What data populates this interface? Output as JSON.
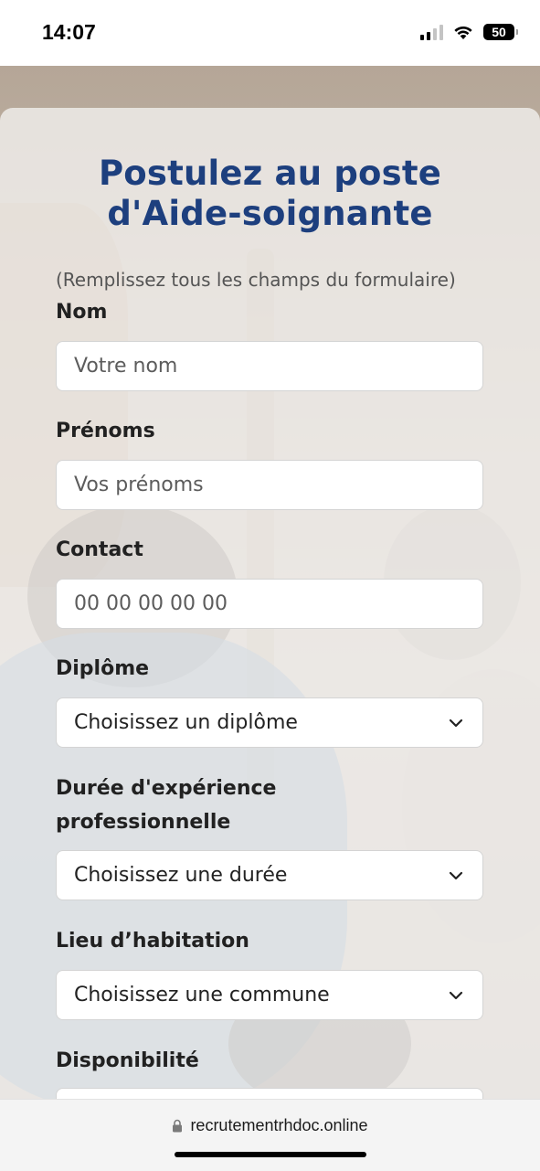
{
  "status_bar": {
    "time": "14:07",
    "battery": "50"
  },
  "form": {
    "title_line1": "Postulez au poste",
    "title_line2": "d'Aide-soignante",
    "instructions": "(Remplissez tous les champs du formulaire)",
    "fields": [
      {
        "label": "Nom",
        "placeholder": "Votre nom"
      },
      {
        "label": "Prénoms",
        "placeholder": "Vos prénoms"
      },
      {
        "label": "Contact",
        "placeholder": "00 00 00 00 00"
      },
      {
        "label": "Diplôme",
        "selected": "Choisissez un diplôme"
      },
      {
        "label_line1": "Durée d'expérience",
        "label_line2": "professionnelle",
        "selected": "Choisissez une durée"
      },
      {
        "label": "Lieu d’habitation",
        "selected": "Choisissez une commune"
      },
      {
        "label": "Disponibilité"
      }
    ]
  },
  "browser": {
    "url": "recrutementrhdoc.online"
  },
  "colors": {
    "title": "#1d3f7e",
    "label": "#212121",
    "field_bg": "#ffffff"
  }
}
